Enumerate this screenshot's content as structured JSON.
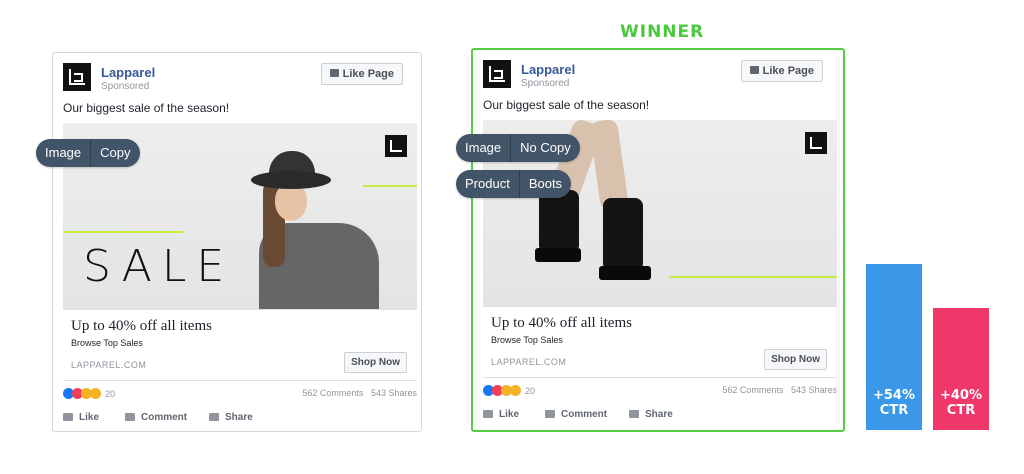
{
  "winner_label": "WINNER",
  "ads": [
    {
      "brand": "Lapparel",
      "sponsored": "Sponsored",
      "like_page": "Like Page",
      "caption": "Our biggest sale of the season!",
      "sale_text": "SALE",
      "headline": "Up to 40% off all items",
      "subline": "Browse Top Sales",
      "domain": "LAPPAREL.COM",
      "cta": "Shop Now",
      "reaction_count": "20",
      "comments": "562 Comments",
      "shares": "543 Shares",
      "like": "Like",
      "comment": "Comment",
      "share": "Share",
      "tags": [
        [
          "Image",
          "Copy"
        ]
      ]
    },
    {
      "brand": "Lapparel",
      "sponsored": "Sponsored",
      "like_page": "Like Page",
      "caption": "Our biggest sale of the season!",
      "headline": "Up to 40% off all items",
      "subline": "Browse Top Sales",
      "domain": "LAPPAREL.COM",
      "cta": "Shop Now",
      "reaction_count": "20",
      "comments": "562 Comments",
      "shares": "543 Shares",
      "like": "Like",
      "comment": "Comment",
      "share": "Share",
      "tags": [
        [
          "Image",
          "No Copy"
        ],
        [
          "Product",
          "Boots"
        ]
      ]
    }
  ],
  "results": [
    {
      "value": "+54%",
      "metric": "CTR",
      "color": "#3b97e8"
    },
    {
      "value": "+40%",
      "metric": "CTR",
      "color": "#f0386b"
    }
  ],
  "colors": {
    "winner": "#4cc83d",
    "accent_line": "#c6ee42",
    "brand_link": "#385898"
  }
}
